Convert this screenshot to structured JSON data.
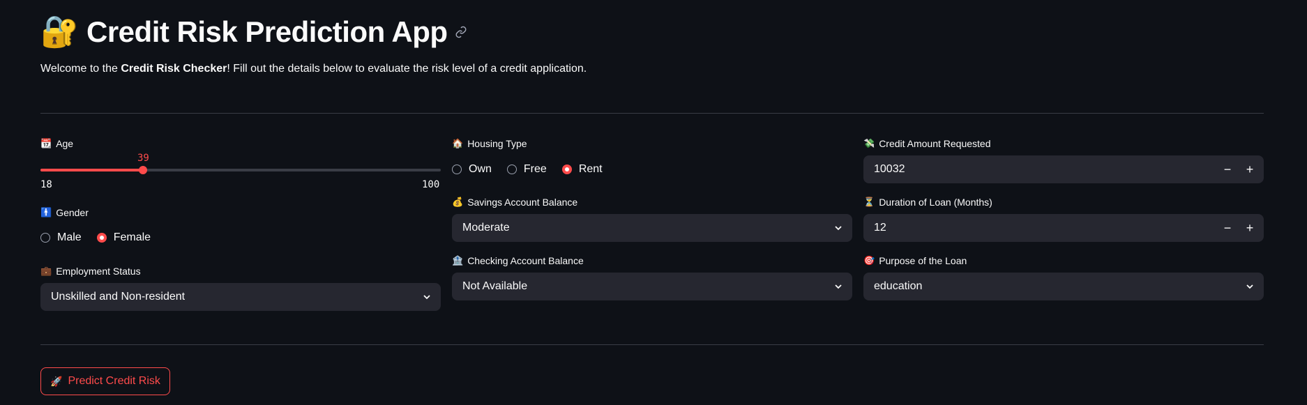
{
  "header": {
    "title_emoji": "🔐",
    "title": "Credit Risk Prediction App",
    "intro_prefix": "Welcome to the ",
    "intro_bold": "Credit Risk Checker",
    "intro_suffix": "! Fill out the details below to evaluate the risk level of a credit application."
  },
  "age": {
    "icon": "calendar-icon",
    "emoji": "📆",
    "label": "Age",
    "value": 39,
    "value_text": "39",
    "min": 18,
    "max": 100,
    "min_text": "18",
    "max_text": "100"
  },
  "gender": {
    "icon": "person-icon",
    "emoji": "🚹",
    "label": "Gender",
    "options": [
      "Male",
      "Female"
    ],
    "selected": "Female"
  },
  "employment": {
    "icon": "briefcase-icon",
    "emoji": "💼",
    "label": "Employment Status",
    "value": "Unskilled and Non-resident"
  },
  "housing": {
    "icon": "house-icon",
    "emoji": "🏠",
    "label": "Housing Type",
    "options": [
      "Own",
      "Free",
      "Rent"
    ],
    "selected": "Rent"
  },
  "savings": {
    "icon": "money-bag-icon",
    "emoji": "💰",
    "label": "Savings Account Balance",
    "value": "Moderate"
  },
  "checking": {
    "icon": "bank-icon",
    "emoji": "🏦",
    "label": "Checking Account Balance",
    "value": "Not Available"
  },
  "credit_amount": {
    "icon": "money-wings-icon",
    "emoji": "💸",
    "label": "Credit Amount Requested",
    "value": "10032",
    "minus": "−",
    "plus": "+"
  },
  "duration": {
    "icon": "hourglass-icon",
    "emoji": "⏳",
    "label": "Duration of Loan (Months)",
    "value": "12",
    "minus": "−",
    "plus": "+"
  },
  "purpose": {
    "icon": "target-icon",
    "emoji": "🎯",
    "label": "Purpose of the Loan",
    "value": "education"
  },
  "predict_button": {
    "emoji": "🚀",
    "label": "Predict Credit Risk"
  },
  "colors": {
    "accent": "#ff4b4b",
    "background": "#0e1117",
    "widget_bg": "#262730"
  }
}
